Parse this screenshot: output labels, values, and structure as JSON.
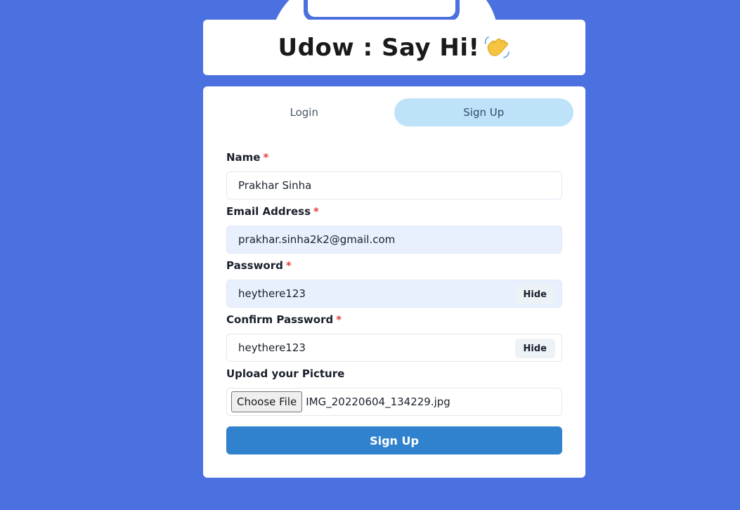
{
  "header": {
    "title": "Udow : Say Hi!",
    "emoji_icon": "waving-hand-icon"
  },
  "tabs": [
    {
      "label": "Login",
      "active": false
    },
    {
      "label": "Sign Up",
      "active": true
    }
  ],
  "form": {
    "name": {
      "label": "Name",
      "required_mark": "*",
      "value": "Prakhar Sinha"
    },
    "email": {
      "label": "Email Address",
      "required_mark": "*",
      "value": "prakhar.sinha2k2@gmail.com"
    },
    "password": {
      "label": "Password",
      "required_mark": "*",
      "value": "heythere123",
      "toggle_label": "Hide"
    },
    "confirm_password": {
      "label": "Confirm Password",
      "required_mark": "*",
      "value": "heythere123",
      "toggle_label": "Hide"
    },
    "picture": {
      "label": "Upload your Picture",
      "button_label": "Choose File",
      "file_name": "IMG_20220604_134229.jpg"
    },
    "submit_label": "Sign Up"
  },
  "colors": {
    "background": "#4b70df",
    "active_tab": "#bee3f8",
    "submit": "#3182ce",
    "required": "#e53e3e",
    "autofill": "#e8f0fe"
  }
}
